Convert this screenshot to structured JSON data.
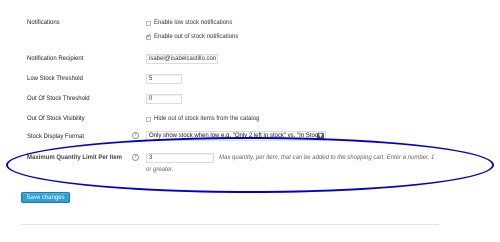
{
  "settings": {
    "notifications": {
      "label": "Notifications",
      "options": [
        {
          "label": "Enable low stock notifications",
          "checked": false
        },
        {
          "label": "Enable out of stock notifications",
          "checked": true
        }
      ]
    },
    "recipient": {
      "label": "Notification Recipient",
      "value": "isabel@isabelcastillo.con"
    },
    "low_stock": {
      "label": "Low Stock Threshold",
      "value": "5"
    },
    "out_of_stock": {
      "label": "Out Of Stock Threshold",
      "value": "0"
    },
    "visibility": {
      "label": "Out Of Stock Visibility",
      "option_label": "Hide out of stock items from the catalog",
      "checked": false
    },
    "display_format": {
      "label": "Stock Display Format",
      "help": "?",
      "selected": "Only show stock when low e.g. \"Only 2 left in stock\" vs. \"In Stock\""
    },
    "max_qty": {
      "label": "Maximum Quantity Limit Per Item",
      "help": "?",
      "value": "3",
      "description_line1": "Max quantity, per item, that can be added to the shopping cart. Enter a number, 1",
      "description_line2": "or greater."
    }
  },
  "actions": {
    "save_label": "Save changes"
  },
  "colors": {
    "button": "#2e9fd1",
    "highlight": "#0000cc",
    "checkmark": "#1e8cbe"
  }
}
